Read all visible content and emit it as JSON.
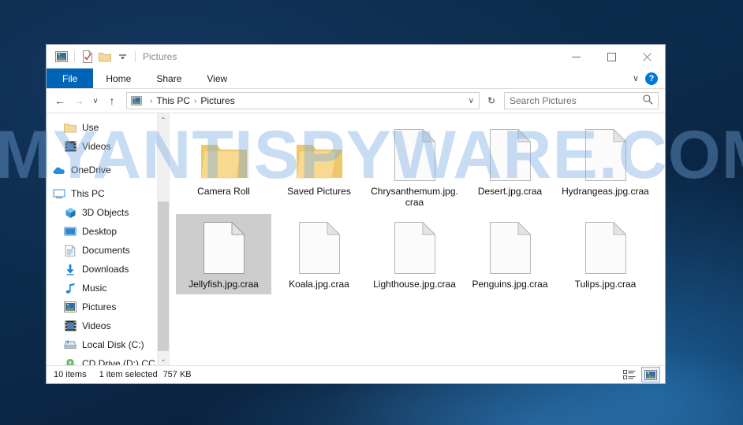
{
  "window": {
    "title": "Pictures",
    "quick_access": [
      {
        "name": "pictures-icon",
        "glyph": "picture"
      },
      {
        "name": "properties-icon",
        "glyph": "checkpage"
      },
      {
        "name": "new-folder-icon",
        "glyph": "folder"
      },
      {
        "name": "customize-qat-icon",
        "glyph": "caret"
      }
    ],
    "controls": {
      "minimize": "—",
      "maximize": "☐",
      "close": "✕"
    }
  },
  "ribbon": {
    "tabs": [
      {
        "label": "File",
        "active": true
      },
      {
        "label": "Home",
        "active": false
      },
      {
        "label": "Share",
        "active": false
      },
      {
        "label": "View",
        "active": false
      }
    ],
    "collapse_label": "∨",
    "help_label": "?"
  },
  "address": {
    "back_label": "←",
    "forward_label": "→",
    "recent_label": "∨",
    "up_label": "↑",
    "crumbs": [
      "This PC",
      "Pictures"
    ],
    "crumb_separator": "›",
    "dropdown_label": "∨",
    "refresh_label": "↻"
  },
  "search": {
    "placeholder": "Search Pictures",
    "value": "",
    "icon": "search-icon"
  },
  "sidebar": {
    "items": [
      {
        "label": "Use",
        "icon": "folder-icon",
        "indent": "indent",
        "group": false
      },
      {
        "label": "Videos",
        "icon": "videos-icon",
        "indent": "indent",
        "group": false
      },
      {
        "label": "OneDrive",
        "icon": "onedrive-icon",
        "indent": "group",
        "group": true
      },
      {
        "label": "This PC",
        "icon": "thispc-icon",
        "indent": "group",
        "group": true
      },
      {
        "label": "3D Objects",
        "icon": "3dobjects-icon",
        "indent": "indent",
        "group": false
      },
      {
        "label": "Desktop",
        "icon": "desktop-icon",
        "indent": "indent",
        "group": false
      },
      {
        "label": "Documents",
        "icon": "documents-icon",
        "indent": "indent",
        "group": false
      },
      {
        "label": "Downloads",
        "icon": "downloads-icon",
        "indent": "indent",
        "group": false
      },
      {
        "label": "Music",
        "icon": "music-icon",
        "indent": "indent",
        "group": false
      },
      {
        "label": "Pictures",
        "icon": "pictures-icon",
        "indent": "indent",
        "group": false
      },
      {
        "label": "Videos",
        "icon": "videos-icon",
        "indent": "indent",
        "group": false
      },
      {
        "label": "Local Disk (C:)",
        "icon": "localdisk-icon",
        "indent": "indent",
        "group": false
      },
      {
        "label": "CD Drive (D:) CC",
        "icon": "cddrive-icon",
        "indent": "indent",
        "group": false
      }
    ],
    "scroll_up": "⌃",
    "scroll_down": "⌄"
  },
  "files": [
    {
      "name": "Camera Roll",
      "type": "folder",
      "selected": false
    },
    {
      "name": "Saved Pictures",
      "type": "folder",
      "selected": false
    },
    {
      "name": "Chrysanthemum.jpg.craa",
      "type": "file",
      "selected": false
    },
    {
      "name": "Desert.jpg.craa",
      "type": "file",
      "selected": false
    },
    {
      "name": "Hydrangeas.jpg.craa",
      "type": "file",
      "selected": false
    },
    {
      "name": "Jellyfish.jpg.craa",
      "type": "file",
      "selected": true
    },
    {
      "name": "Koala.jpg.craa",
      "type": "file",
      "selected": false
    },
    {
      "name": "Lighthouse.jpg.craa",
      "type": "file",
      "selected": false
    },
    {
      "name": "Penguins.jpg.craa",
      "type": "file",
      "selected": false
    },
    {
      "name": "Tulips.jpg.craa",
      "type": "file",
      "selected": false
    }
  ],
  "status": {
    "item_count": "10 items",
    "selection": "1 item selected",
    "size": "757 KB",
    "view_details_icon": "details-view-icon",
    "view_large_icon": "large-icons-view-icon"
  },
  "watermark": {
    "text": "MYANTISPYWARE.COM"
  },
  "colors": {
    "file_tab": "#0064b6",
    "selection": "#cdcdcd",
    "folder": "#f7d27e",
    "help_button": "#0078d7",
    "watermark": "#76aae1"
  }
}
